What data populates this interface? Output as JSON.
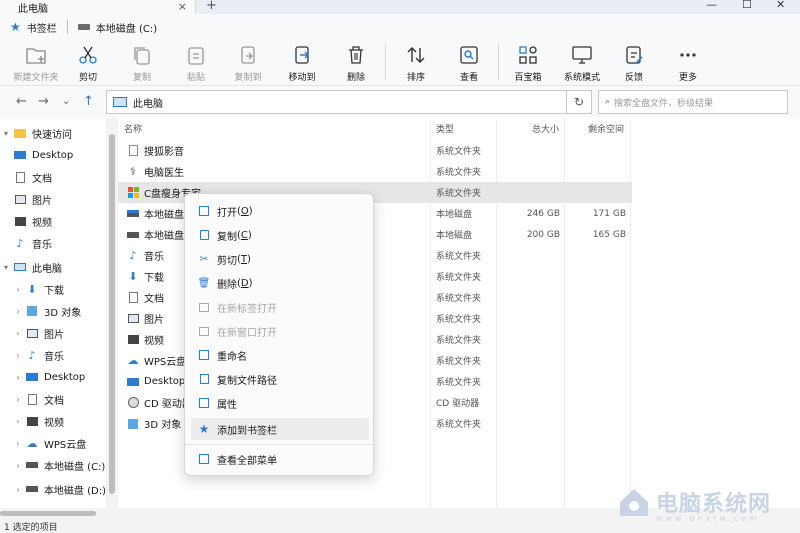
{
  "titlebar": {
    "tab_title": "此电脑",
    "close_glyph": "×",
    "plus_glyph": "+",
    "minimize_glyph": "—",
    "maximize_glyph": "☐",
    "winclose_glyph": "✕"
  },
  "bookmarks": {
    "label": "书签栏",
    "drive_label": "本地磁盘 (C:)"
  },
  "toolbar": {
    "new_folder": "新建文件夹",
    "cut": "剪切",
    "copy": "复制",
    "paste": "粘贴",
    "copy_to": "复制到",
    "move_to": "移动到",
    "delete": "删除",
    "sort": "排序",
    "view": "查看",
    "toolbox": "百宝箱",
    "system_mode": "系统模式",
    "feedback": "反馈",
    "more": "更多"
  },
  "address": {
    "path": "此电脑",
    "search_placeholder": "搜索全盘文件，秒级结果"
  },
  "sidebar": {
    "items": [
      {
        "label": "快速访问"
      },
      {
        "label": "Desktop"
      },
      {
        "label": "文档"
      },
      {
        "label": "图片"
      },
      {
        "label": "视频"
      },
      {
        "label": "音乐"
      },
      {
        "label": "此电脑"
      },
      {
        "label": "下载"
      },
      {
        "label": "3D 对象"
      },
      {
        "label": "图片"
      },
      {
        "label": "音乐"
      },
      {
        "label": "Desktop"
      },
      {
        "label": "文档"
      },
      {
        "label": "视频"
      },
      {
        "label": "WPS云盘"
      },
      {
        "label": "本地磁盘 (C:)"
      },
      {
        "label": "本地磁盘 (D:)"
      }
    ]
  },
  "columns": {
    "name": "名称",
    "type": "类型",
    "total": "总大小",
    "free": "剩余空间"
  },
  "rows": [
    {
      "name": "搜狐影音",
      "type": "系统文件夹",
      "total": "",
      "free": ""
    },
    {
      "name": "电脑医生",
      "type": "系统文件夹",
      "total": "",
      "free": ""
    },
    {
      "name": "C盘瘦身专家",
      "type": "系统文件夹",
      "total": "",
      "free": ""
    },
    {
      "name": "本地磁盘",
      "type": "本地磁盘",
      "total": "246 GB",
      "free": "171 GB"
    },
    {
      "name": "本地磁盘",
      "type": "本地磁盘",
      "total": "200 GB",
      "free": "165 GB"
    },
    {
      "name": "音乐",
      "type": "系统文件夹",
      "total": "",
      "free": ""
    },
    {
      "name": "下载",
      "type": "系统文件夹",
      "total": "",
      "free": ""
    },
    {
      "name": "文档",
      "type": "系统文件夹",
      "total": "",
      "free": ""
    },
    {
      "name": "图片",
      "type": "系统文件夹",
      "total": "",
      "free": ""
    },
    {
      "name": "视频",
      "type": "系统文件夹",
      "total": "",
      "free": ""
    },
    {
      "name": "WPS云盘",
      "type": "系统文件夹",
      "total": "",
      "free": ""
    },
    {
      "name": "Desktop",
      "type": "系统文件夹",
      "total": "",
      "free": ""
    },
    {
      "name": "CD 驱动器",
      "type": "CD 驱动器",
      "total": "",
      "free": ""
    },
    {
      "name": "3D 对象",
      "type": "系统文件夹",
      "total": "",
      "free": ""
    }
  ],
  "context_menu": {
    "open": "打开",
    "open_key": "O",
    "copy": "复制",
    "copy_key": "C",
    "cut": "剪切",
    "cut_key": "T",
    "delete": "删除",
    "delete_key": "D",
    "open_new_tab": "在新标签打开",
    "open_new_window": "在新窗口打开",
    "rename": "重命名",
    "copy_path": "复制文件路径",
    "properties": "属性",
    "add_bookmark": "添加到书签栏",
    "show_all": "查看全部菜单"
  },
  "status": {
    "text": "1 选定的项目"
  },
  "watermark": {
    "title": "电脑系统网",
    "url": "www.dnxtw.com"
  },
  "colors": {
    "accent": "#2b7cd3",
    "folder_yellow": "#f5c542",
    "selection": "#e6e6e6"
  }
}
